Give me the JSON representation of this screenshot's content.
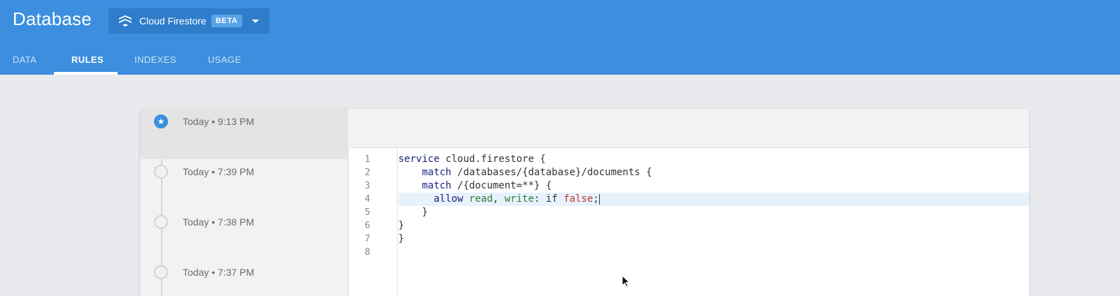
{
  "header": {
    "title": "Database",
    "database_selector": {
      "label": "Cloud Firestore",
      "badge": "BETA"
    }
  },
  "tabs": [
    {
      "label": "DATA",
      "active": false
    },
    {
      "label": "RULES",
      "active": true
    },
    {
      "label": "INDEXES",
      "active": false
    },
    {
      "label": "USAGE",
      "active": false
    }
  ],
  "history": [
    {
      "time": "Today • 9:13 PM",
      "icon": "star-icon",
      "selected": true
    },
    {
      "time": "Today • 7:39 PM",
      "icon": "circle-icon",
      "selected": false
    },
    {
      "time": "Today • 7:38 PM",
      "icon": "circle-icon",
      "selected": false
    },
    {
      "time": "Today • 7:37 PM",
      "icon": "circle-icon",
      "selected": false
    }
  ],
  "editor": {
    "line_numbers": [
      "1",
      "2",
      "3",
      "4",
      "5",
      "6",
      "7",
      "8"
    ],
    "lines": [
      {
        "kw": "service",
        "rest": " cloud.firestore {"
      },
      {
        "indent": "    ",
        "kw": "match",
        "rest": " /databases/{database}/documents {"
      },
      {
        "indent": "    ",
        "kw": "match",
        "rest": " /{document=**} {"
      },
      {
        "indent": "      ",
        "kw": "allow",
        "a": "read",
        "sep": ", ",
        "b": "write",
        "mid": ": if ",
        "c": "false",
        "end": ";"
      },
      {
        "text": "    }"
      },
      {
        "text": "}"
      },
      {
        "text": "}"
      },
      {
        "text": ""
      }
    ],
    "highlighted_line": 4
  },
  "colors": {
    "header_bg": "#3b8fde",
    "accent": "#3b8fde",
    "page_bg": "#e9eaee"
  }
}
